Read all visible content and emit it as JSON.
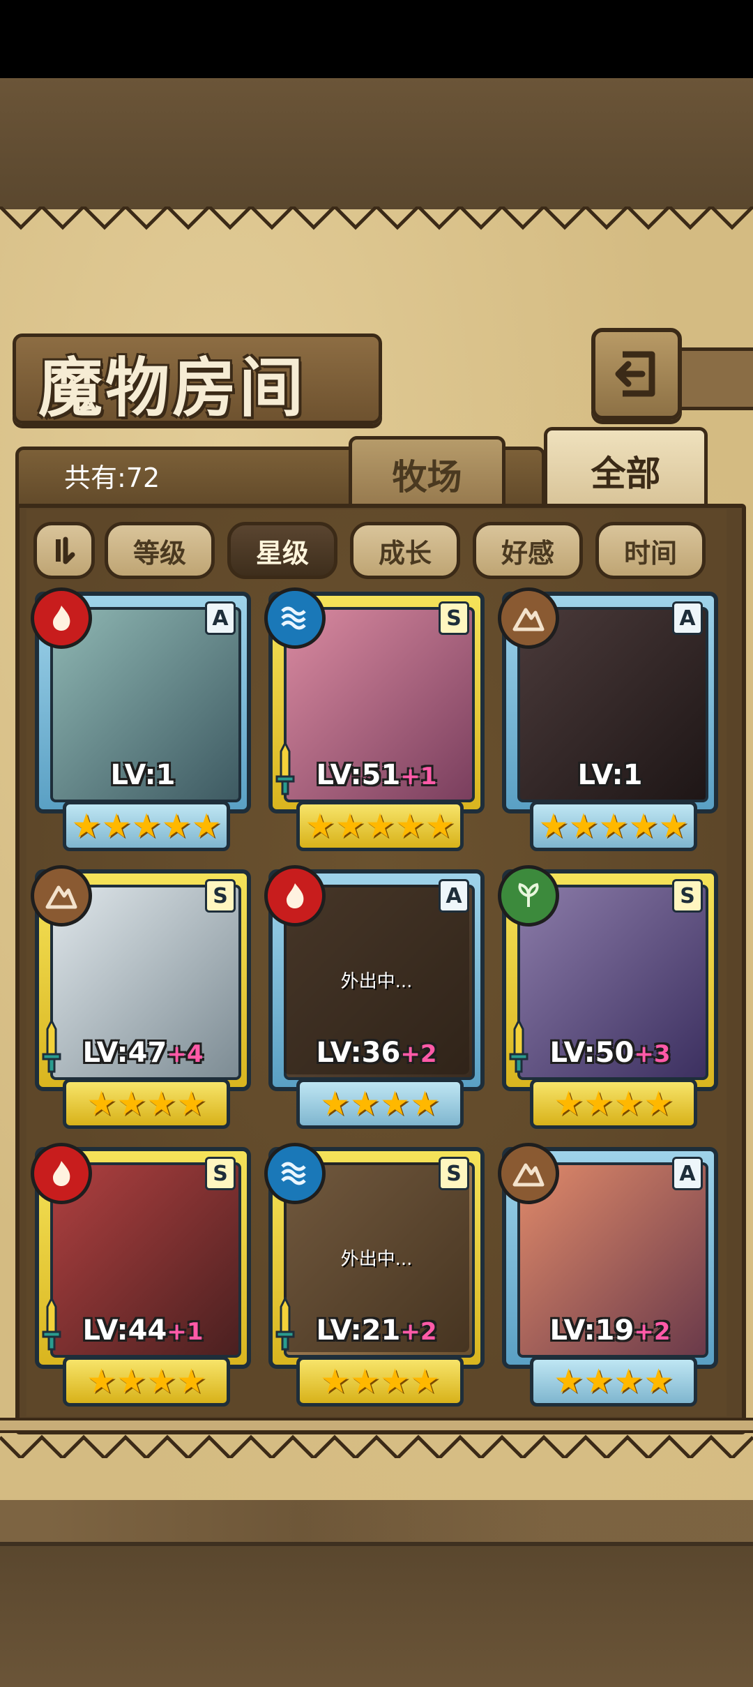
{
  "header": {
    "title": "魔物房间",
    "back_icon": "return-arrow-icon"
  },
  "summary": {
    "count_label": "共有:72"
  },
  "tabs": [
    {
      "label": "牧场",
      "active": false
    },
    {
      "label": "全部",
      "active": true
    }
  ],
  "sort": {
    "toggle_icon": "sort-order-icon",
    "options": [
      {
        "label": "等级",
        "active": false
      },
      {
        "label": "星级",
        "active": true
      },
      {
        "label": "成长",
        "active": false
      },
      {
        "label": "好感",
        "active": false
      },
      {
        "label": "时间",
        "active": false
      }
    ]
  },
  "monsters": [
    {
      "rank": "A",
      "element": "fire",
      "level": "LV:1",
      "bonus": "",
      "stars": "★★★★★",
      "away": ""
    },
    {
      "rank": "S",
      "element": "water",
      "level": "LV:51",
      "bonus": "+1",
      "stars": "★★★★★",
      "away": ""
    },
    {
      "rank": "A",
      "element": "earth",
      "level": "LV:1",
      "bonus": "",
      "stars": "★★★★★",
      "away": ""
    },
    {
      "rank": "S",
      "element": "earth",
      "level": "LV:47",
      "bonus": "+4",
      "stars": "★★★★",
      "away": ""
    },
    {
      "rank": "A",
      "element": "fire",
      "level": "LV:36",
      "bonus": "+2",
      "stars": "★★★★",
      "away": "外出中..."
    },
    {
      "rank": "S",
      "element": "wood",
      "level": "LV:50",
      "bonus": "+3",
      "stars": "★★★★",
      "away": ""
    },
    {
      "rank": "S",
      "element": "fire",
      "level": "LV:44",
      "bonus": "+1",
      "stars": "★★★★",
      "away": ""
    },
    {
      "rank": "S",
      "element": "water",
      "level": "LV:21",
      "bonus": "+2",
      "stars": "★★★★",
      "away": "外出中..."
    },
    {
      "rank": "A",
      "element": "earth",
      "level": "LV:19",
      "bonus": "+2",
      "stars": "★★★★",
      "away": ""
    }
  ],
  "colors": {
    "fire": "#c81d1d",
    "water": "#1a78b8",
    "earth": "#8a5a32",
    "wood": "#3c8a3c",
    "rank_a_frame": "#7fbfdc",
    "rank_s_frame": "#e8c83a"
  }
}
